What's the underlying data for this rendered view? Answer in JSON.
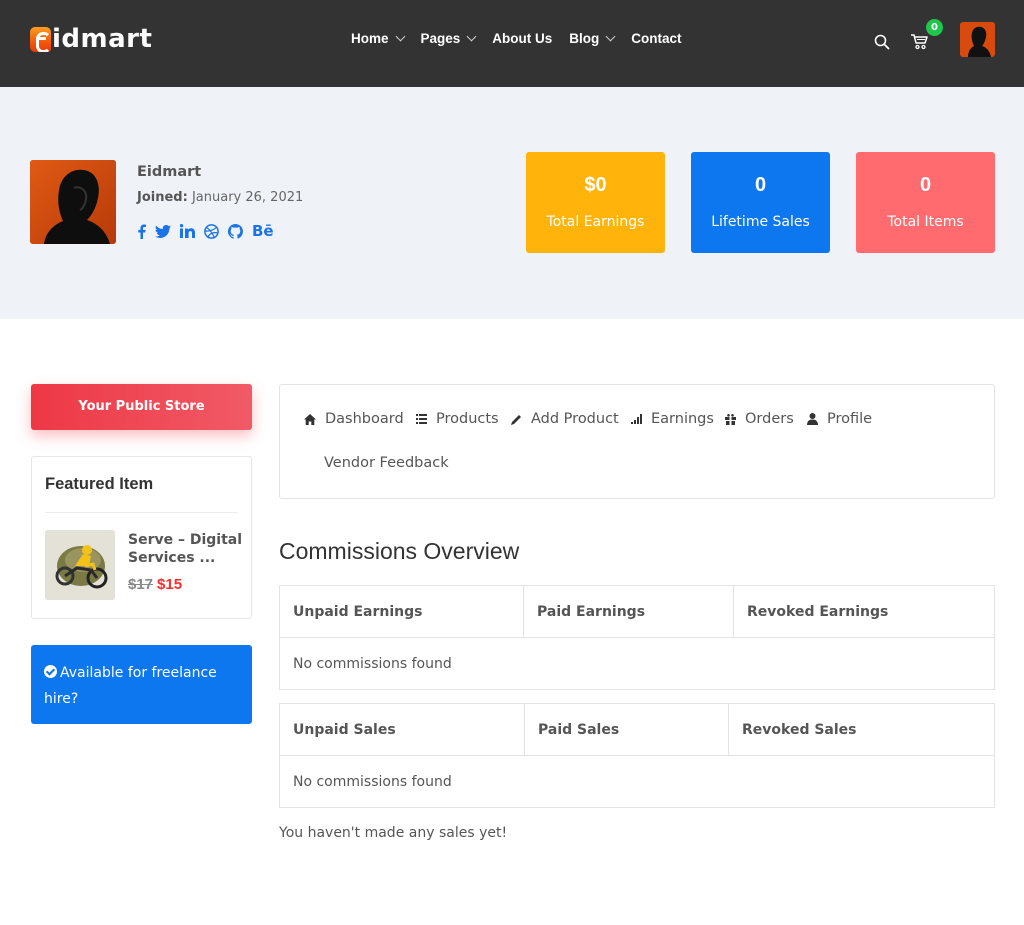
{
  "header": {
    "logo_letter": "e",
    "logo_text": "idmart",
    "nav": [
      {
        "label": "Home",
        "has_dropdown": true
      },
      {
        "label": "Pages",
        "has_dropdown": true
      },
      {
        "label": "About Us",
        "has_dropdown": false
      },
      {
        "label": "Blog",
        "has_dropdown": true
      },
      {
        "label": "Contact",
        "has_dropdown": false
      }
    ],
    "cart_count": "0",
    "icons": [
      "search-icon",
      "cart-icon",
      "user-avatar"
    ]
  },
  "profile": {
    "name": "Eidmart",
    "joined_label": "Joined:",
    "joined_date": "January 26, 2021",
    "social_links": [
      "facebook",
      "twitter",
      "linkedin",
      "dribbble",
      "github",
      "behance"
    ],
    "social_color": "#1a73e8"
  },
  "stats": [
    {
      "value": "$0",
      "label": "Total Earnings",
      "color": "#ffb30b"
    },
    {
      "value": "0",
      "label": "Lifetime Sales",
      "color": "#0c77ee"
    },
    {
      "value": "0",
      "label": "Total Items",
      "color": "#ff6b6e"
    }
  ],
  "sidebar": {
    "store_button": "Your Public Store",
    "featured": {
      "title": "Featured Item",
      "item_name": "Serve – Digital Services ...",
      "old_price": "$17",
      "new_price": "$15"
    },
    "freelance": "Available for freelance hire?"
  },
  "tabs": [
    {
      "label": "Dashboard",
      "icon": "home-icon"
    },
    {
      "label": "Products",
      "icon": "list-icon"
    },
    {
      "label": "Add Product",
      "icon": "pencil-icon"
    },
    {
      "label": "Earnings",
      "icon": "signal-icon"
    },
    {
      "label": "Orders",
      "icon": "gift-icon"
    },
    {
      "label": "Profile",
      "icon": "user-icon"
    },
    {
      "label": "Vendor Feedback",
      "icon": ""
    }
  ],
  "commissions": {
    "title": "Commissions Overview",
    "earnings_table": {
      "headers": [
        "Unpaid Earnings",
        "Paid Earnings",
        "Revoked Earnings"
      ],
      "empty": "No commissions found"
    },
    "sales_table": {
      "headers": [
        "Unpaid Sales",
        "Paid Sales",
        "Revoked Sales"
      ],
      "empty": "No commissions found"
    },
    "note": "You haven't made any sales yet!"
  }
}
